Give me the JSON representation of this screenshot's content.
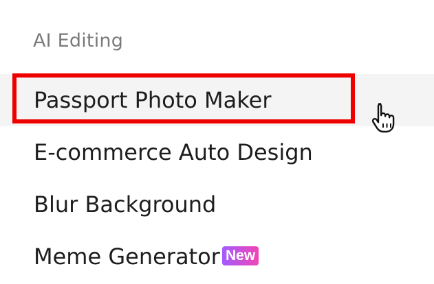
{
  "menu": {
    "section_title": "AI Editing",
    "items": [
      {
        "label": "Passport Photo Maker",
        "state": "hovered",
        "highlighted": true
      },
      {
        "label": "E-commerce Auto Design"
      },
      {
        "label": "Blur Background"
      },
      {
        "label": "Meme Generator",
        "badge": "New"
      }
    ]
  },
  "colors": {
    "highlight_border": "#ef0000",
    "hover_background": "#f4f4f4",
    "badge_gradient_start": "#a35bff",
    "badge_gradient_end": "#f046b6"
  },
  "icons": {
    "cursor": "hand-pointer-icon"
  }
}
